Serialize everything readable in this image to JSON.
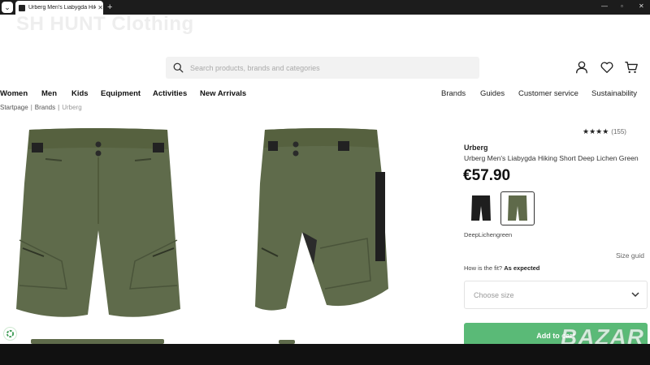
{
  "browser": {
    "tab_title": "Urberg Men's Liabygda Hiking",
    "new_tab": "+",
    "minimize": "—",
    "maximize": "▫",
    "close": "✕"
  },
  "site": {
    "name": "SH HUNT Clothing"
  },
  "search": {
    "placeholder": "Search products, brands and categories"
  },
  "nav": {
    "left": [
      "Women",
      "Men",
      "Kids",
      "Equipment",
      "Activities",
      "New Arrivals"
    ],
    "right": [
      "Brands",
      "Guides",
      "Customer service",
      "Sustainability"
    ]
  },
  "breadcrumb": [
    "Startpage",
    "Brands",
    "Urberg"
  ],
  "product": {
    "rating_stars": "★★★★",
    "rating_value": 4,
    "review_count": "(155)",
    "brand": "Urberg",
    "name": "Urberg Men's Liabygda Hiking Short Deep Lichen Green",
    "price": "€57.90",
    "swatches": [
      {
        "color": "#1e1e1e",
        "selected": false
      },
      {
        "color": "#5f6a4a",
        "selected": true
      }
    ],
    "color_name": "DeepLichengreen",
    "size_guide": "Size guid",
    "fit_label": "How is the fit?",
    "fit_value": "As expected",
    "size_placeholder": "Choose size",
    "add_to_cart": "Add to cart",
    "main_color": "#5f6b4b"
  },
  "watermark": "BAZAR"
}
